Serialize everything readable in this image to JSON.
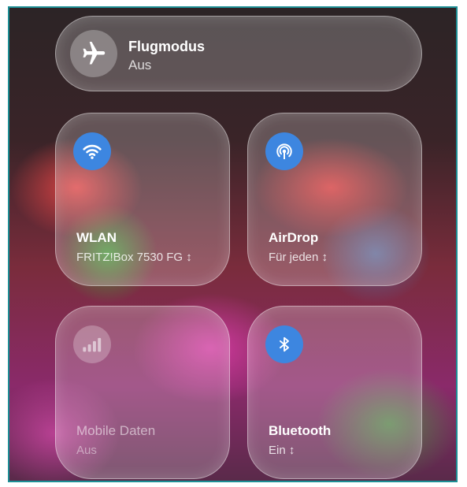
{
  "airplane": {
    "title": "Flugmodus",
    "status": "Aus",
    "icon": "airplane-icon"
  },
  "tiles": [
    {
      "title": "WLAN",
      "subtitle": "FRITZ!Box 7530 FG ↕",
      "icon": "wifi-icon",
      "active": true,
      "accent": "#3d86e0"
    },
    {
      "title": "AirDrop",
      "subtitle": "Für jeden ↕",
      "icon": "airdrop-icon",
      "active": true,
      "accent": "#3d86e0"
    },
    {
      "title": "Mobile Daten",
      "subtitle": "Aus",
      "icon": "cellular-signal-icon",
      "active": false
    },
    {
      "title": "Bluetooth",
      "subtitle": "Ein ↕",
      "icon": "bluetooth-icon",
      "active": true,
      "accent": "#3d86e0"
    }
  ]
}
